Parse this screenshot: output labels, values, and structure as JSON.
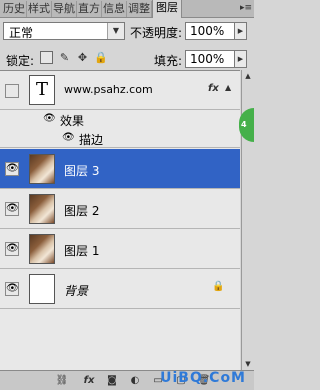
{
  "tabs": [
    "历史",
    "样式",
    "导航",
    "直方",
    "信息",
    "调整",
    "图层"
  ],
  "active_tab_index": 6,
  "blend_mode": "正常",
  "opacity_label": "不透明度:",
  "opacity_value": "100%",
  "lock_label": "锁定:",
  "fill_label": "填充:",
  "fill_value": "100%",
  "layers": {
    "text_layer": {
      "name": "www.psahz.com",
      "thumb_letter": "T",
      "fx": "fx"
    },
    "effects_label": "效果",
    "stroke_label": "描边",
    "layer3": "图层 3",
    "layer2": "图层 2",
    "layer1": "图层 1",
    "background": "背景"
  },
  "watermark": "UiBQ.CoM",
  "colors": {
    "selection": "#3163c5",
    "badge": "#45b04a",
    "watermark": "#2f7ad8"
  }
}
